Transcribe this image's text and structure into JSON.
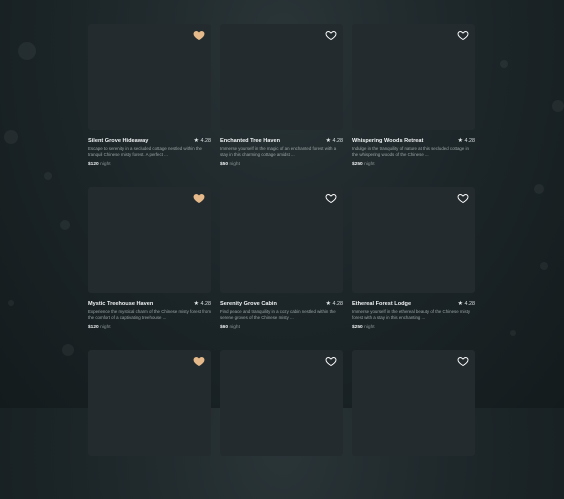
{
  "colors": {
    "background": "#1b2427",
    "card_placeholder": "#232b2e",
    "favorite_active": "#e5b98a",
    "favorite_inactive": "#ffffff"
  },
  "price_unit": "night",
  "listings": [
    {
      "name": "Silent Grove Hideaway",
      "rating": "4.28",
      "description": "Escape to serenity in a secluded cottage nestled within the tranquil Chinese misty forest. A perfect ...",
      "price": "$120",
      "favorited": true
    },
    {
      "name": "Enchanted Tree Haven",
      "rating": "4.28",
      "description": "Immerse yourself in the magic of an enchanted forest with a stay in this charming cottage amidst ...",
      "price": "$50",
      "favorited": false
    },
    {
      "name": "Whispering Woods Retreat",
      "rating": "4.28",
      "description": "Indulge in the tranquility of nature at this secluded cottage in the whispering woods of the Chinese ...",
      "price": "$250",
      "favorited": false
    },
    {
      "name": "Mystic Treehouse Haven",
      "rating": "4.28",
      "description": "Experience the mystical charm of the Chinese misty forest from the comfort of a captivating treehouse ...",
      "price": "$120",
      "favorited": true
    },
    {
      "name": "Serenity Grove Cabin",
      "rating": "4.28",
      "description": "Find peace and tranquility in a cozy cabin nestled within the serene groves of the Chinese misty ...",
      "price": "$60",
      "favorited": false
    },
    {
      "name": "Ethereal Forest Lodge",
      "rating": "4.28",
      "description": "Immerse yourself in the ethereal beauty of the Chinese misty forest with a stay in this enchanting ...",
      "price": "$250",
      "favorited": false
    },
    {
      "name": "",
      "rating": "",
      "description": "",
      "price": "",
      "favorited": true
    },
    {
      "name": "",
      "rating": "",
      "description": "",
      "price": "",
      "favorited": false
    },
    {
      "name": "",
      "rating": "",
      "description": "",
      "price": "",
      "favorited": false
    }
  ]
}
